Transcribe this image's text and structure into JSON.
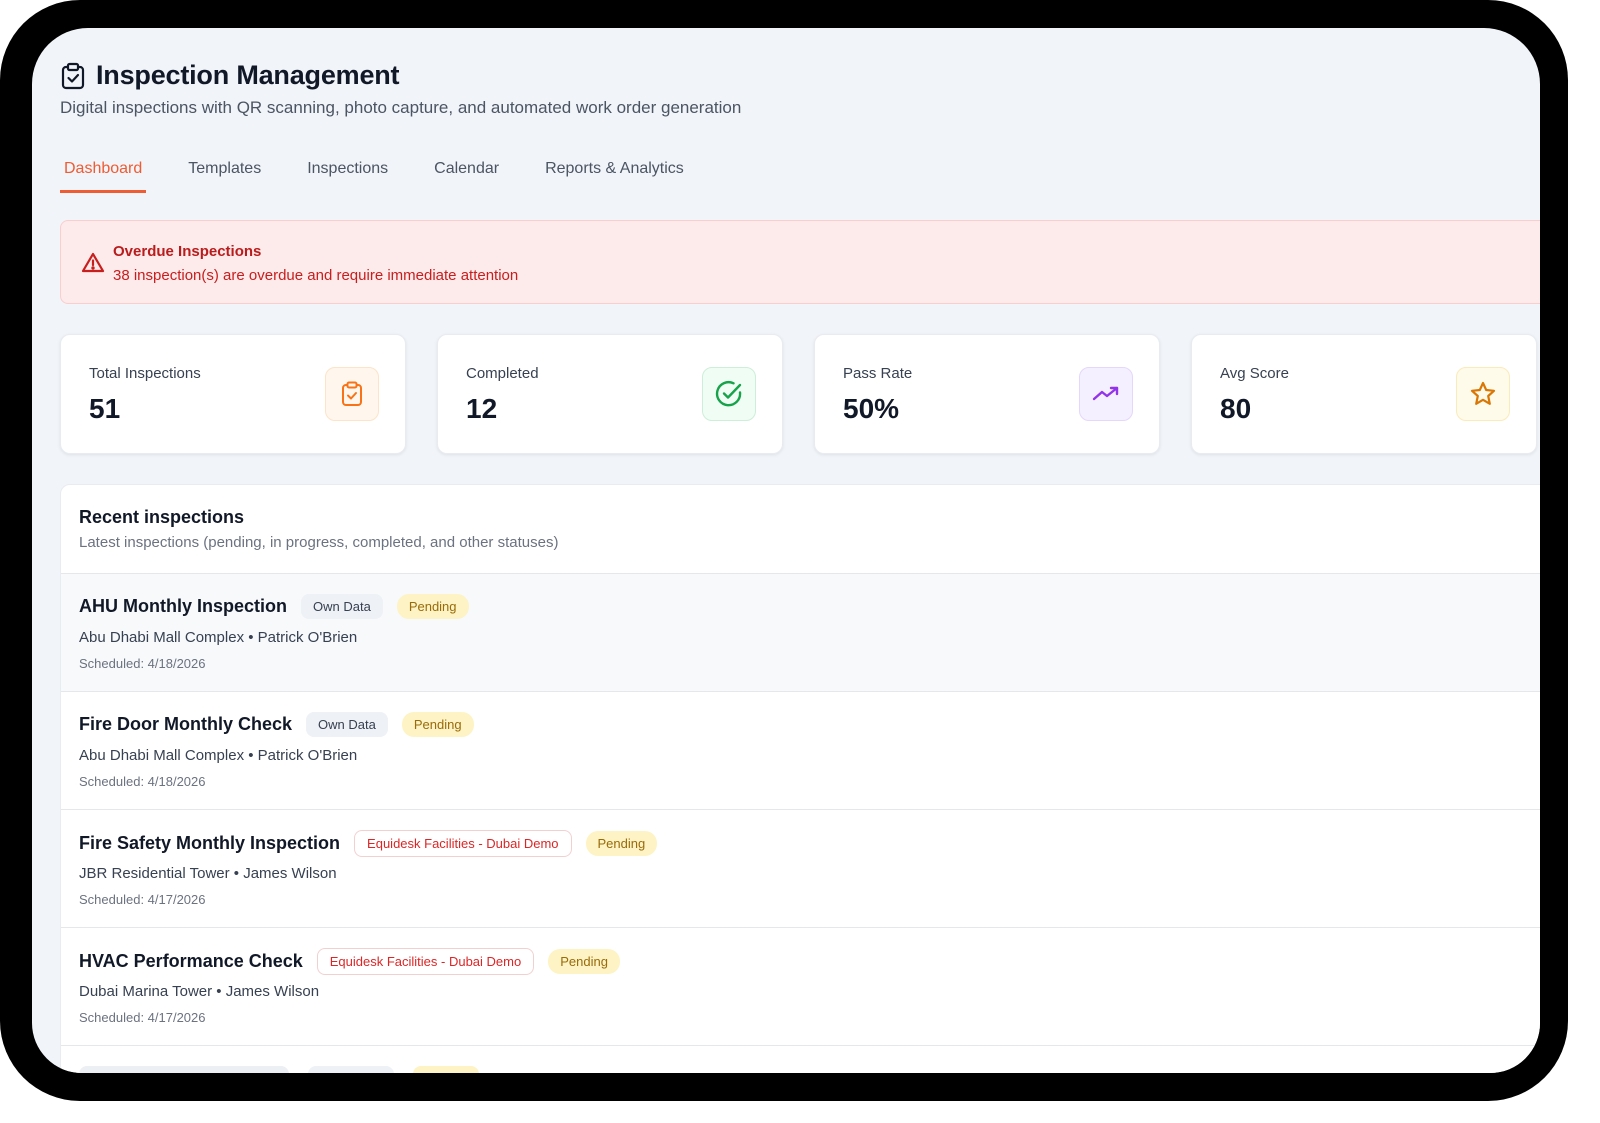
{
  "header": {
    "title": "Inspection Management",
    "subtitle": "Digital inspections with QR scanning, photo capture, and automated work order generation"
  },
  "tabs": [
    {
      "label": "Dashboard",
      "active": true
    },
    {
      "label": "Templates",
      "active": false
    },
    {
      "label": "Inspections",
      "active": false
    },
    {
      "label": "Calendar",
      "active": false
    },
    {
      "label": "Reports & Analytics",
      "active": false
    }
  ],
  "alert": {
    "title": "Overdue Inspections",
    "message": "38 inspection(s) are overdue and require immediate attention"
  },
  "stats": [
    {
      "label": "Total Inspections",
      "value": "51",
      "icon": "clipboard-check-icon",
      "color": "#f97316"
    },
    {
      "label": "Completed",
      "value": "12",
      "icon": "check-circle-icon",
      "color": "#16a34a"
    },
    {
      "label": "Pass Rate",
      "value": "50%",
      "icon": "trending-up-icon",
      "color": "#9333ea"
    },
    {
      "label": "Avg Score",
      "value": "80",
      "icon": "star-icon",
      "color": "#d97706"
    }
  ],
  "recent": {
    "title": "Recent inspections",
    "description": "Latest inspections (pending, in progress, completed, and other statuses)",
    "items": [
      {
        "name": "AHU Monthly Inspection",
        "org": "Own Data",
        "status": "Pending",
        "location": "Abu Dhabi Mall Complex • Patrick O'Brien",
        "scheduled": "Scheduled: 4/18/2026"
      },
      {
        "name": "Fire Door Monthly Check",
        "org": "Own Data",
        "status": "Pending",
        "location": "Abu Dhabi Mall Complex • Patrick O'Brien",
        "scheduled": "Scheduled: 4/18/2026"
      },
      {
        "name": "Fire Safety Monthly Inspection",
        "org": "Equidesk Facilities - Dubai Demo",
        "status": "Pending",
        "location": "JBR Residential Tower • James Wilson",
        "scheduled": "Scheduled: 4/17/2026"
      },
      {
        "name": "HVAC Performance Check",
        "org": "Equidesk Facilities - Dubai Demo",
        "status": "Pending",
        "location": "Dubai Marina Tower • James Wilson",
        "scheduled": "Scheduled: 4/17/2026"
      }
    ]
  },
  "colors": {
    "accent": "#ef5b33",
    "alert_bg": "#fdeaea",
    "alert_text": "#c81e1e",
    "pending_bg": "#fdf3c4"
  }
}
